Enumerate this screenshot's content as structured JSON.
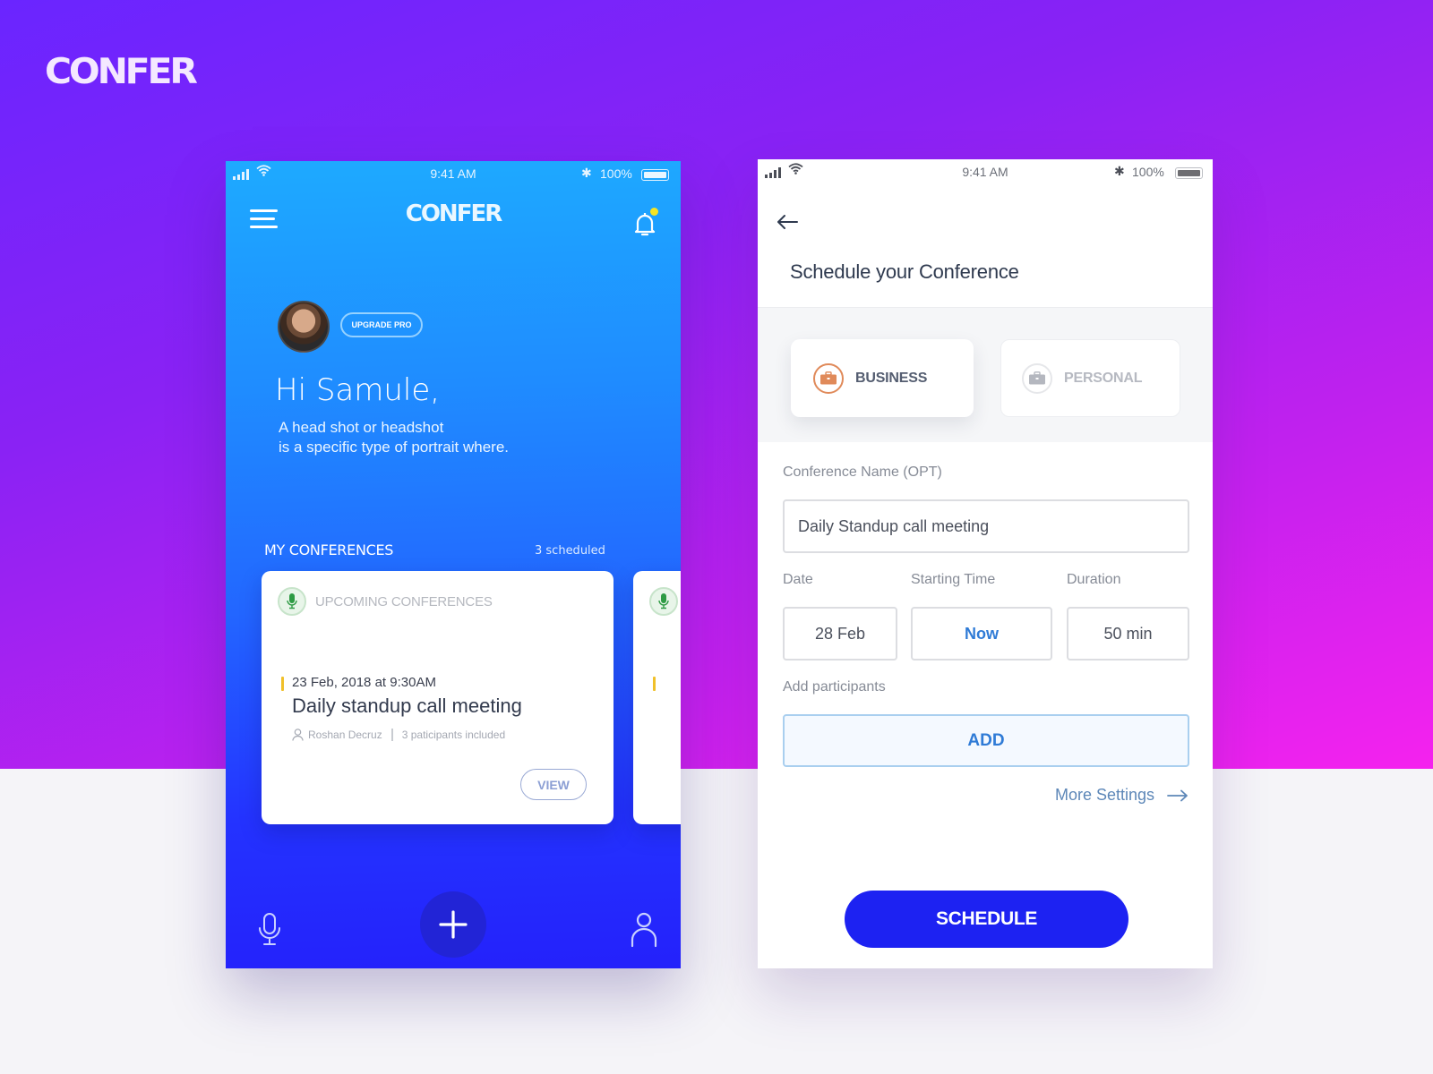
{
  "brand": {
    "name": "CONFER"
  },
  "colors": {
    "primary_blue": "#1d22f2",
    "accent_yellow": "#f5e425",
    "business_orange": "#e08a5a",
    "link_blue": "#2f7bd6",
    "mic_green": "#2e9b44"
  },
  "home_screen": {
    "status_bar": {
      "time": "9:41 AM",
      "battery": "100%"
    },
    "header": {
      "logo": "CONFER",
      "menu_icon": "hamburger-icon",
      "notification_icon": "bell-icon",
      "has_unread": true
    },
    "profile": {
      "upgrade_label": "UPGRADE PRO"
    },
    "greeting": "Hi Samule,",
    "intro_line1": "A head shot or headshot",
    "intro_line2": "is a specific type of portrait where.",
    "conferences": {
      "heading": "MY CONFERENCES",
      "count_label": "3 scheduled",
      "cards": [
        {
          "category": "UPCOMING CONFERENCES",
          "datetime": "23 Feb, 2018 at 9:30AM",
          "title": "Daily standup call meeting",
          "host": "Roshan Decruz",
          "participants": "3 paticipants included",
          "action": "VIEW"
        }
      ]
    },
    "bottom_nav": {
      "left": "microphone-icon",
      "center": "add-icon",
      "right": "user-icon"
    }
  },
  "schedule_screen": {
    "status_bar": {
      "time": "9:41 AM",
      "battery": "100%"
    },
    "title": "Schedule your Conference",
    "types": [
      {
        "label": "BUSINESS",
        "selected": true
      },
      {
        "label": "PERSONAL",
        "selected": false
      }
    ],
    "name_field": {
      "label": "Conference Name (OPT)",
      "value": "Daily Standup call meeting"
    },
    "date_field": {
      "label": "Date",
      "value": "28 Feb"
    },
    "start_field": {
      "label": "Starting Time",
      "value": "Now"
    },
    "duration_field": {
      "label": "Duration",
      "value": "50 min"
    },
    "participants": {
      "label": "Add participants",
      "button": "ADD"
    },
    "more_settings": "More Settings",
    "submit": "SCHEDULE"
  }
}
